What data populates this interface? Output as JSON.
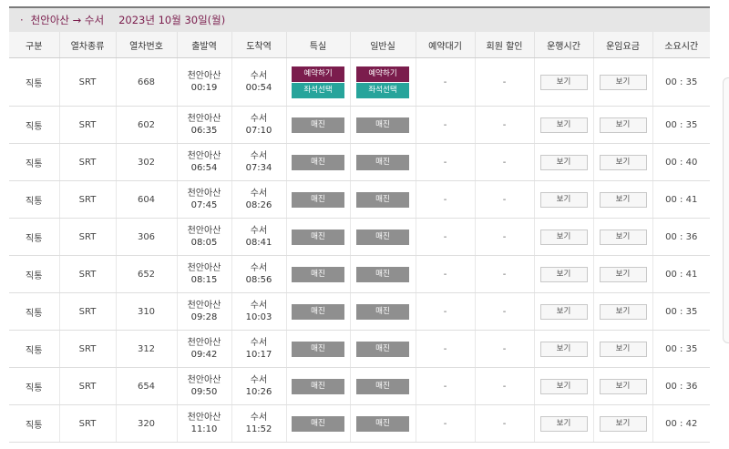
{
  "title": {
    "bullet": "·",
    "route": "천안아산 → 수서",
    "date": "2023년 10월 30일(월)"
  },
  "headers": [
    "구분",
    "열차종류",
    "열차번호",
    "출발역",
    "도착역",
    "특실",
    "일반실",
    "예약대기",
    "회원 할인",
    "운행시간",
    "운임요금",
    "소요시간"
  ],
  "labels": {
    "reserve": "예약하기",
    "seat_select": "좌석선택",
    "sold_out": "매진",
    "view": "보기",
    "dash": "-"
  },
  "rows": [
    {
      "type": "직통",
      "kind": "SRT",
      "no": "668",
      "dep": "천안아산",
      "dep_time": "00:19",
      "arr": "수서",
      "arr_time": "00:54",
      "available": true,
      "duration": "00 : 35"
    },
    {
      "type": "직통",
      "kind": "SRT",
      "no": "602",
      "dep": "천안아산",
      "dep_time": "06:35",
      "arr": "수서",
      "arr_time": "07:10",
      "available": false,
      "duration": "00 : 35"
    },
    {
      "type": "직통",
      "kind": "SRT",
      "no": "302",
      "dep": "천안아산",
      "dep_time": "06:54",
      "arr": "수서",
      "arr_time": "07:34",
      "available": false,
      "duration": "00 : 40"
    },
    {
      "type": "직통",
      "kind": "SRT",
      "no": "604",
      "dep": "천안아산",
      "dep_time": "07:45",
      "arr": "수서",
      "arr_time": "08:26",
      "available": false,
      "duration": "00 : 41"
    },
    {
      "type": "직통",
      "kind": "SRT",
      "no": "306",
      "dep": "천안아산",
      "dep_time": "08:05",
      "arr": "수서",
      "arr_time": "08:41",
      "available": false,
      "duration": "00 : 36"
    },
    {
      "type": "직통",
      "kind": "SRT",
      "no": "652",
      "dep": "천안아산",
      "dep_time": "08:15",
      "arr": "수서",
      "arr_time": "08:56",
      "available": false,
      "duration": "00 : 41"
    },
    {
      "type": "직통",
      "kind": "SRT",
      "no": "310",
      "dep": "천안아산",
      "dep_time": "09:28",
      "arr": "수서",
      "arr_time": "10:03",
      "available": false,
      "duration": "00 : 35"
    },
    {
      "type": "직통",
      "kind": "SRT",
      "no": "312",
      "dep": "천안아산",
      "dep_time": "09:42",
      "arr": "수서",
      "arr_time": "10:17",
      "available": false,
      "duration": "00 : 35"
    },
    {
      "type": "직통",
      "kind": "SRT",
      "no": "654",
      "dep": "천안아산",
      "dep_time": "09:50",
      "arr": "수서",
      "arr_time": "10:26",
      "available": false,
      "duration": "00 : 36"
    },
    {
      "type": "직통",
      "kind": "SRT",
      "no": "320",
      "dep": "천안아산",
      "dep_time": "11:10",
      "arr": "수서",
      "arr_time": "11:52",
      "available": false,
      "duration": "00 : 42"
    }
  ],
  "colors": {
    "reserve": "#7b1d4d",
    "seat_select": "#27a49b",
    "sold_out": "#8f8f8f",
    "title_text": "#7b1d4d"
  }
}
